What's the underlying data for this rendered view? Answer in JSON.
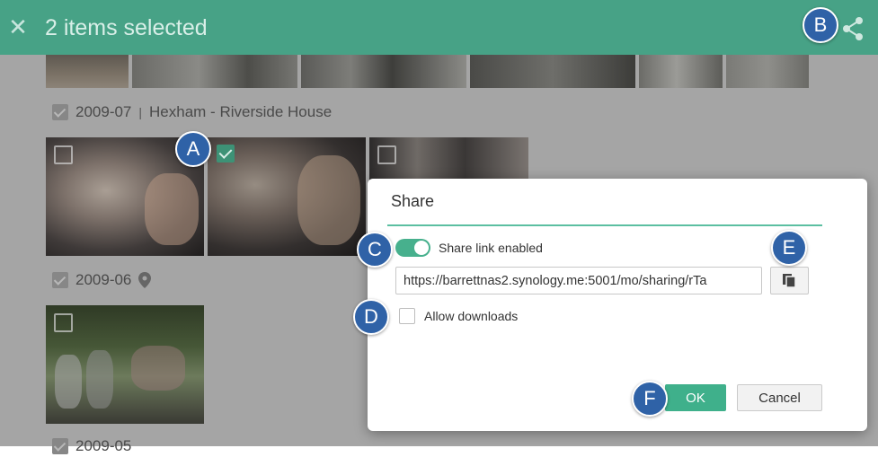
{
  "topbar": {
    "close_icon": "close-icon",
    "title": "2 items selected",
    "share_icon": "share-icon"
  },
  "groups": [
    {
      "date": "2009-07",
      "separator": "|",
      "location": "Hexham - Riverside House"
    },
    {
      "date": "2009-06",
      "location_icon": "map-pin-icon"
    },
    {
      "date": "2009-05"
    }
  ],
  "dialog": {
    "title": "Share",
    "share_link_label": "Share link enabled",
    "share_link_enabled": true,
    "url_value": "https://barrettnas2.synology.me:5001/mo/sharing/rTa",
    "copy_icon": "copy-icon",
    "allow_downloads_label": "Allow downloads",
    "allow_downloads_checked": false,
    "ok_label": "OK",
    "cancel_label": "Cancel"
  },
  "callouts": {
    "a": "A",
    "b": "B",
    "c": "C",
    "d": "D",
    "e": "E",
    "f": "F"
  },
  "colors": {
    "topbar": "#47a286",
    "accent": "#3fb08b",
    "callout": "#2f62a7",
    "backdrop": "#a5a5a5"
  }
}
